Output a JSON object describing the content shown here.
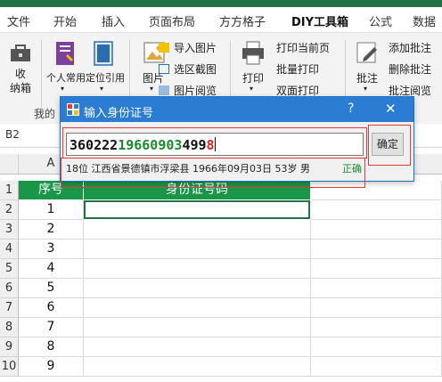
{
  "ribbon_tabs": [
    "文件",
    "开始",
    "插入",
    "页面布局",
    "方方格子",
    "DIY工具箱",
    "公式",
    "数据"
  ],
  "ribbon": {
    "btn_collect": "收\n纳箱",
    "btn_personal": "个人常用",
    "btn_locate": "定位引用",
    "btn_image": "图片",
    "img_import": "导入图片",
    "img_crop": "选区截图",
    "img_browse": "图片阅览",
    "btn_print": "打印",
    "print_current": "打印当前页",
    "print_batch": "批量打印",
    "print_duplex": "双面打印",
    "btn_comment": "批注",
    "comment_add": "添加批注",
    "comment_delete": "删除批注",
    "comment_browse": "批注阅览",
    "group_label": "我的"
  },
  "namebox": "B2",
  "sheet": {
    "col_a": "A",
    "rows": [
      "1",
      "2",
      "3",
      "4",
      "5",
      "6",
      "7",
      "8",
      "9",
      "10"
    ],
    "header_no": "序号",
    "header_id": "身份证号码",
    "numbers": [
      "1",
      "2",
      "3",
      "4",
      "5",
      "6",
      "7",
      "8",
      "9"
    ]
  },
  "dialog": {
    "title": "输入身份证号",
    "help": "?",
    "close": "✕",
    "id_part1": "360222",
    "id_part2": "19660903",
    "id_part3": "499",
    "id_part4": "8",
    "ok_label": "确定",
    "info_text": "18位  江西省景德镇市浮梁县  1966年09月03日  53岁  男",
    "status": "正确"
  },
  "colors": {
    "accent_green": "#217346",
    "header_green": "#1a9648",
    "dialog_blue": "#2b7cd3",
    "id_green": "#1a8a2e",
    "id_red": "#e02020"
  }
}
